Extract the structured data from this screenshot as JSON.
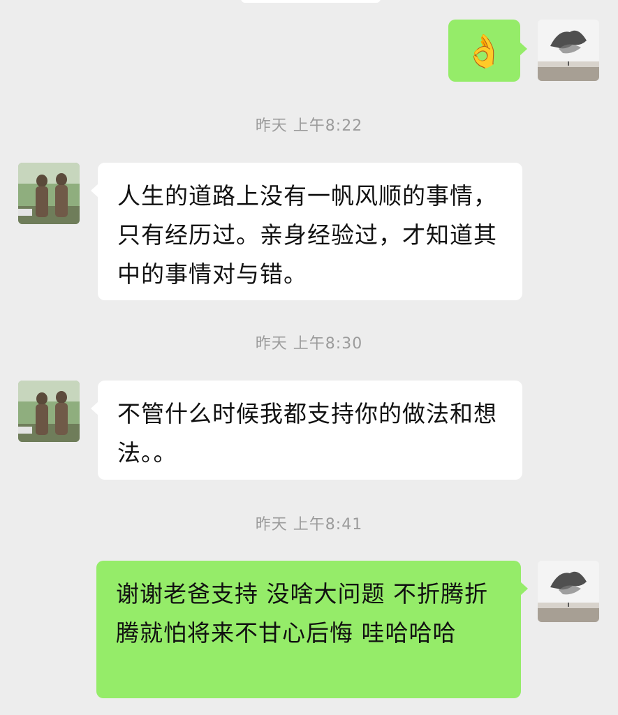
{
  "chat": {
    "messages": [
      {
        "sender": "self",
        "type": "emoji",
        "emoji": "👌",
        "icon": "ok-hand-emoji"
      },
      {
        "type": "timestamp",
        "text": "昨天 上午8:22"
      },
      {
        "sender": "dad",
        "type": "text",
        "text": "人生的道路上没有一帆风顺的事情，只有经历过。亲身经验过，才知道其中的事情对与错。"
      },
      {
        "type": "timestamp",
        "text": "昨天 上午8:30"
      },
      {
        "sender": "dad",
        "type": "text",
        "text": "不管什么时候我都支持你的做法和想法。。"
      },
      {
        "type": "timestamp",
        "text": "昨天 上午8:41"
      },
      {
        "sender": "self",
        "type": "text",
        "text": "谢谢老爸支持 没啥大问题 不折腾折腾就怕将来不甘心后悔 哇哈哈哈"
      }
    ]
  },
  "colors": {
    "background": "#ededed",
    "incoming_bubble": "#ffffff",
    "outgoing_bubble": "#95ec69",
    "timestamp_text": "#9b9b9b"
  }
}
